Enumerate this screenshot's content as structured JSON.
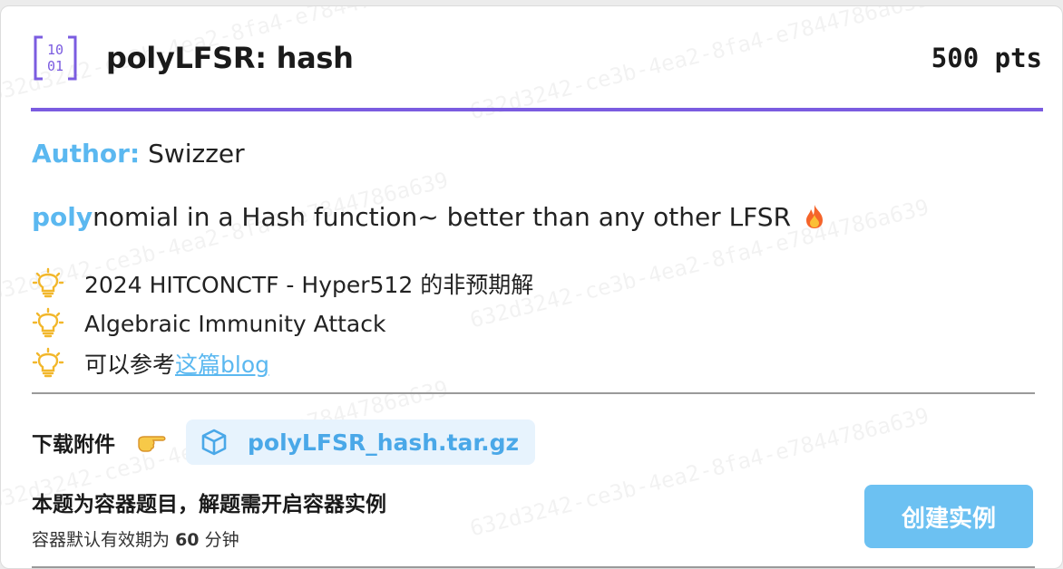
{
  "challenge": {
    "title": "polyLFSR: hash",
    "points": "500 pts"
  },
  "author": {
    "label": "Author:",
    "name": "Swizzer"
  },
  "description": {
    "highlight": "poly",
    "rest": "nomial in a Hash function~ better than any other LFSR"
  },
  "hints": [
    {
      "text": "2024 HITCONCTF - Hyper512 的非预期解"
    },
    {
      "text": "Algebraic Immunity Attack"
    },
    {
      "prefix": "可以参考",
      "link": "这篇blog"
    }
  ],
  "download": {
    "label": "下载附件",
    "file": "polyLFSR_hash.tar.gz"
  },
  "container": {
    "notice": "本题为容器题目，解题需开启容器实例",
    "validity_prefix": "容器默认有效期为",
    "validity_minutes": "60",
    "validity_unit": "分钟",
    "create_button": "创建实例"
  },
  "watermark": "632d3242-ce3b-4ea2-8fa4-e7844786a639",
  "colors": {
    "accent_purple": "#7b5ce0",
    "accent_blue": "#5bb8f0",
    "button_blue": "#6cc1f2"
  }
}
